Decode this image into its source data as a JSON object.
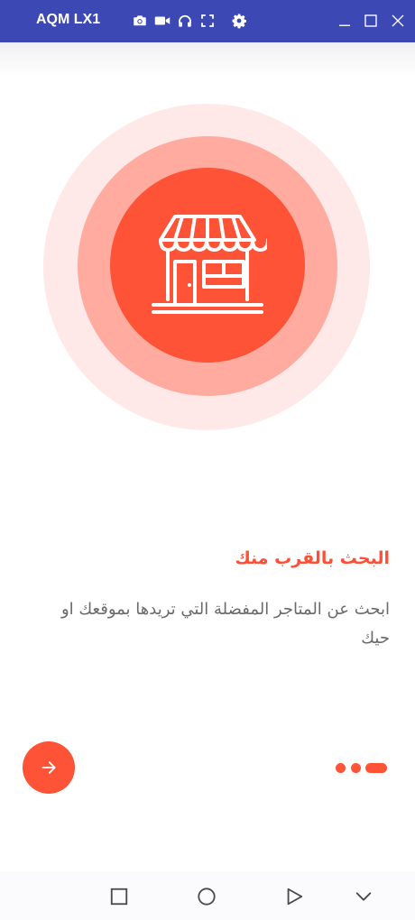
{
  "window": {
    "title": "AQM LX1",
    "toolbar_icons": [
      "camera-icon",
      "video-icon",
      "headphones-icon",
      "fullscreen-icon",
      "settings-icon"
    ],
    "controls": [
      "minimize-icon",
      "maximize-icon",
      "close-icon"
    ]
  },
  "onboarding": {
    "illustration": "store-icon",
    "heading": "البحث بالقرب منك",
    "description": "ابحث عن المتاجر المفضلة التي تريدها بموقعك او حيك",
    "page_indicator": {
      "pages": 3,
      "active": 3
    },
    "next_icon": "arrow-right-icon"
  },
  "navbar": {
    "buttons": [
      "square-icon",
      "circle-icon",
      "triangle-play-icon",
      "chevron-down-icon"
    ]
  },
  "colors": {
    "titlebar": "#3c48b4",
    "accent": "#ff5337",
    "accent_mid": "#ffaba0",
    "accent_light": "#ffe9e8",
    "heading_text": "#ff4e36",
    "body_text": "#6a6a6a"
  }
}
